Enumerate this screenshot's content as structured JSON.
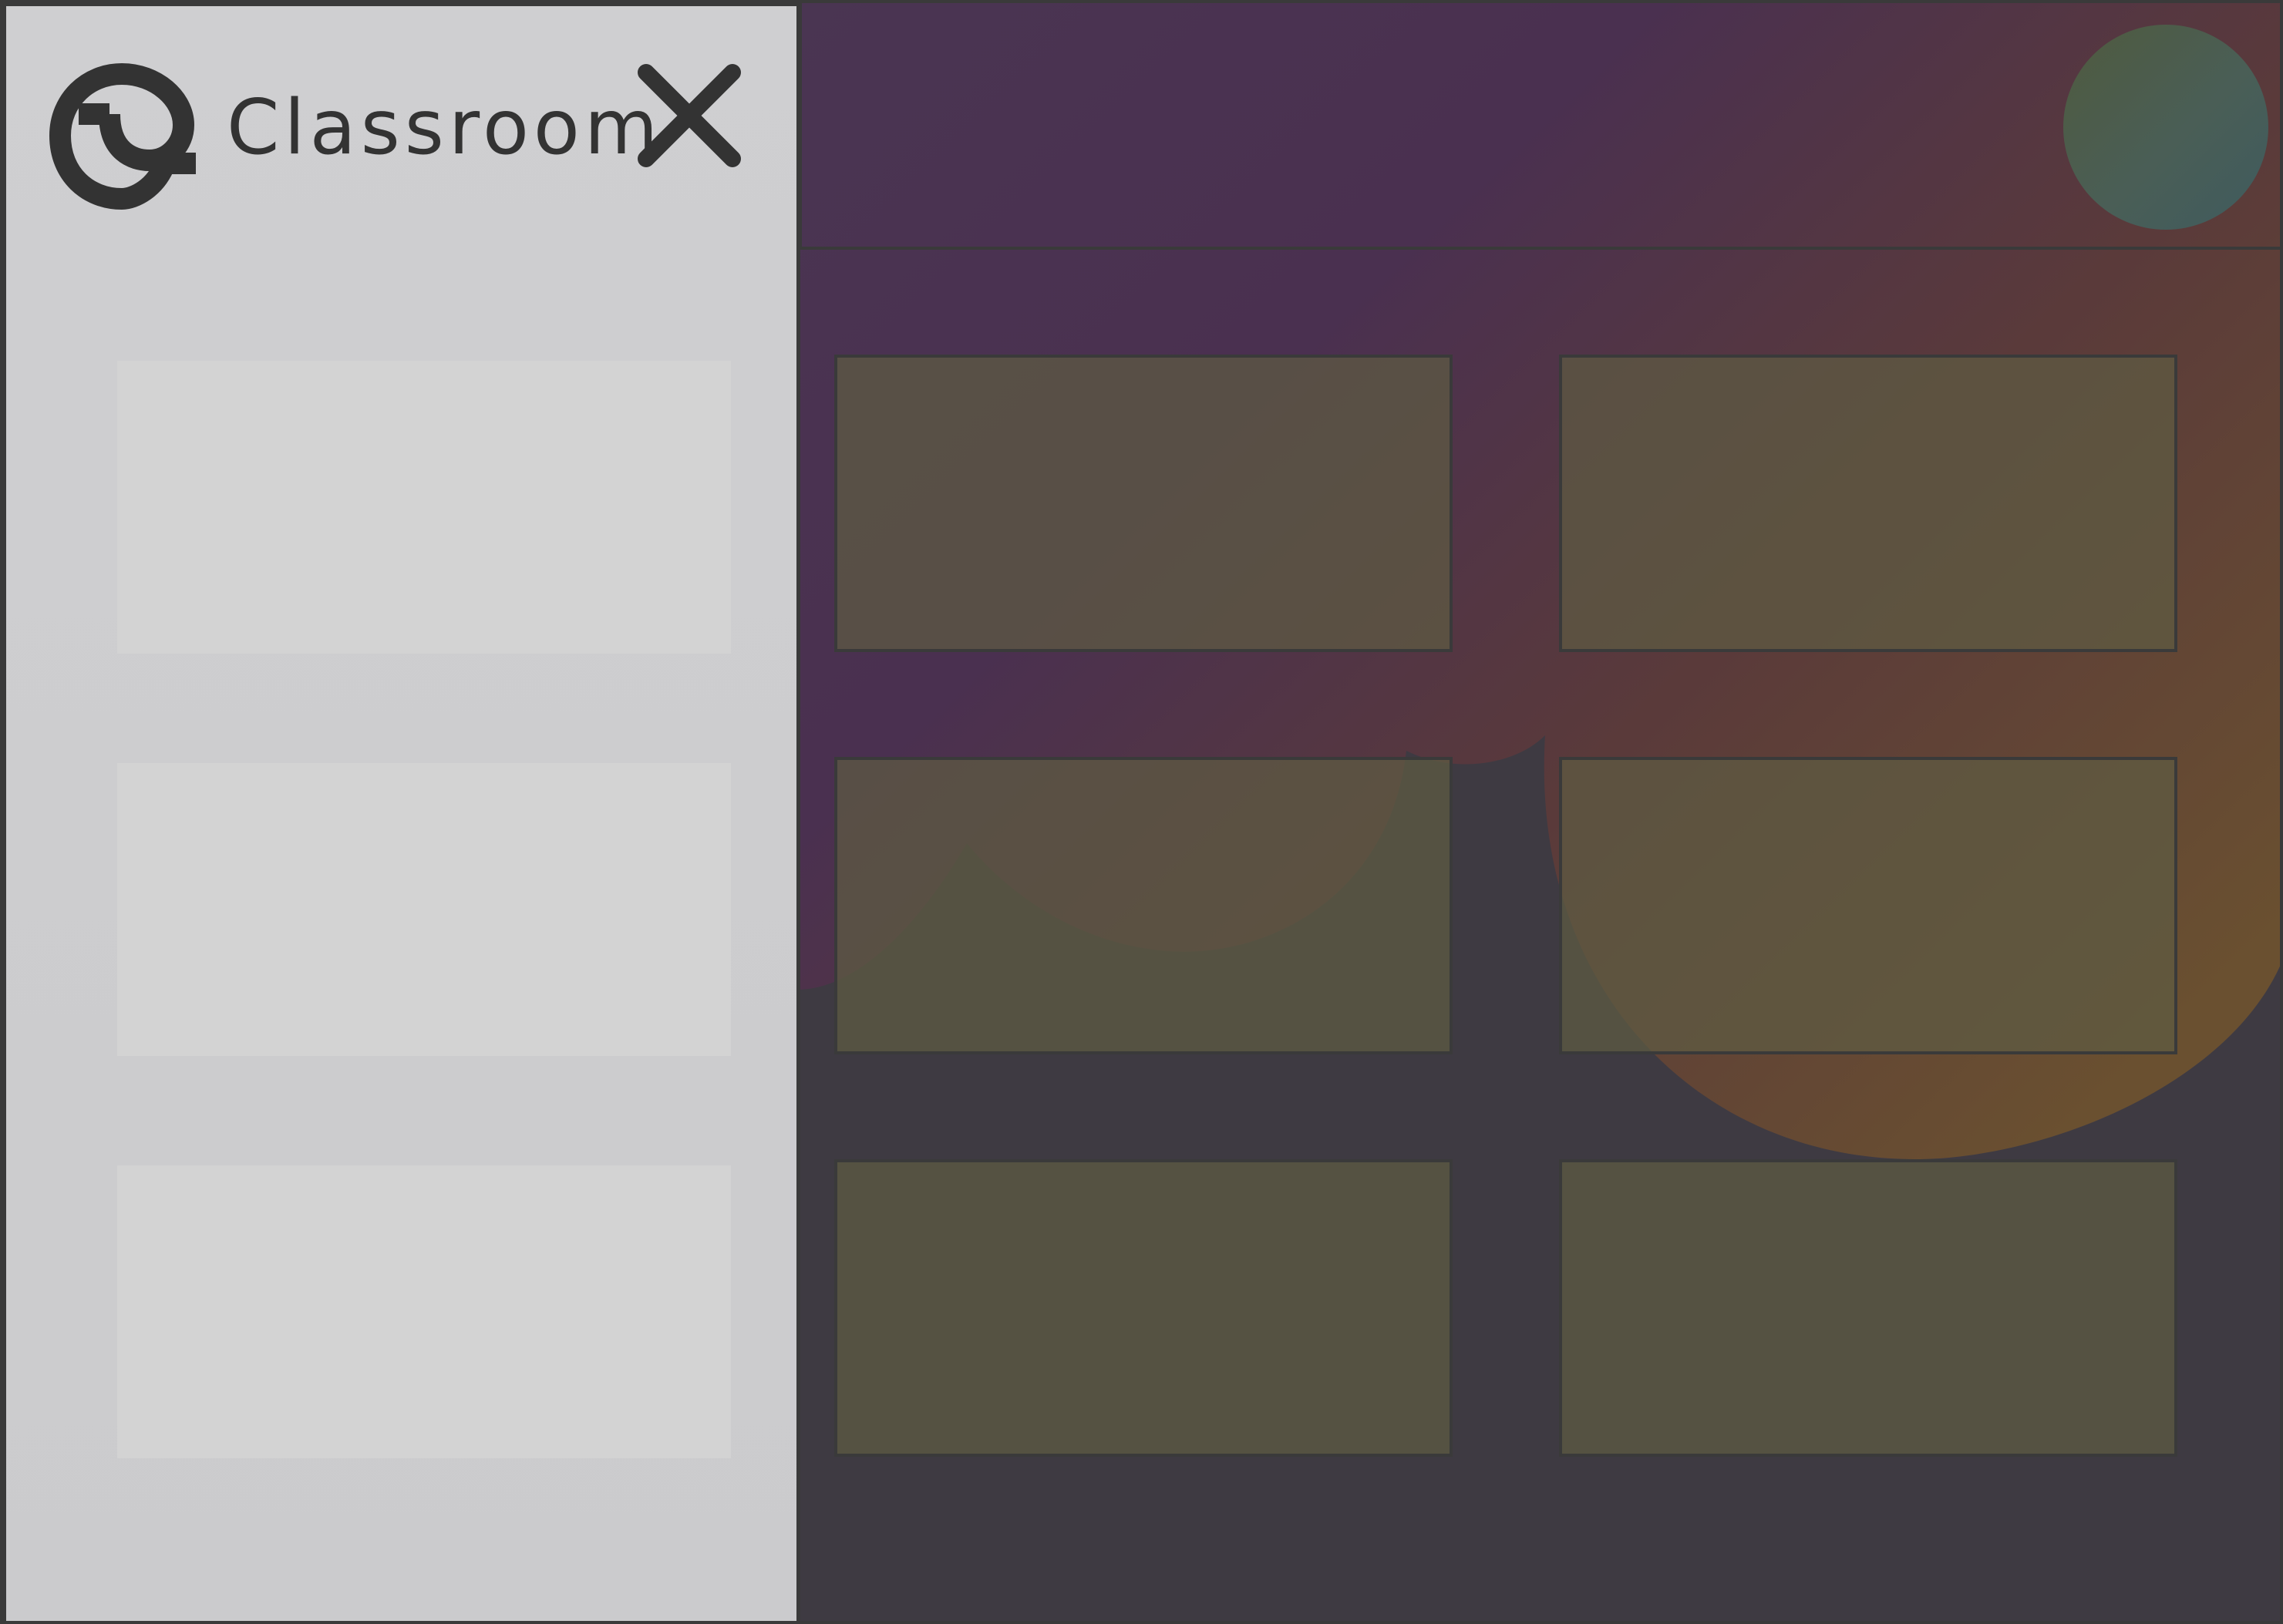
{
  "app": {
    "title": "Classroom"
  },
  "icons": {
    "brand": "spiral-logo-icon",
    "close": "close-icon"
  },
  "drawer": {
    "items": [
      {
        "label": ""
      },
      {
        "label": ""
      },
      {
        "label": ""
      }
    ]
  },
  "courses": [
    {
      "name": ""
    },
    {
      "name": ""
    },
    {
      "name": ""
    },
    {
      "name": ""
    },
    {
      "name": ""
    },
    {
      "name": ""
    }
  ],
  "colors": {
    "drawer_background": "#cdcdcf",
    "drawer_item": "#d3d3d3",
    "icon_text": "#333333",
    "main_background": "#3e3a42",
    "card_fill": "#5e5c42",
    "accent_purple": "#4a2e55",
    "accent_orange": "#6e4a2a"
  }
}
